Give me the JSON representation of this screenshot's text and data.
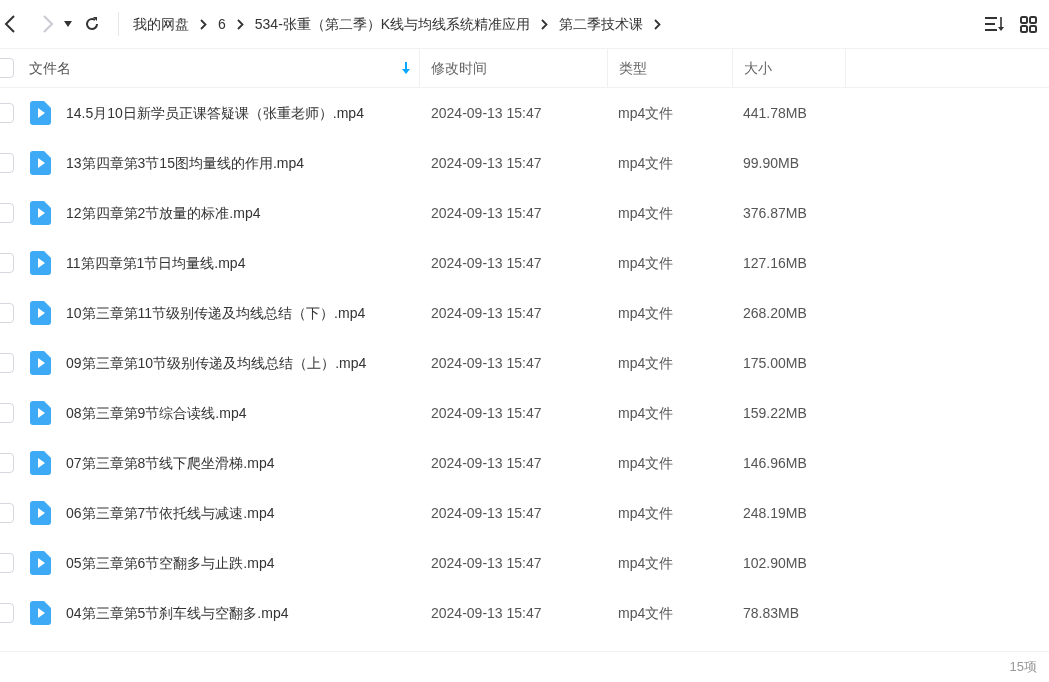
{
  "nav": {
    "back_disabled": false,
    "forward_disabled": true
  },
  "breadcrumb": [
    "我的网盘",
    "6",
    "534-张重（第二季）K线与均线系统精准应用",
    "第二季技术课"
  ],
  "columns": [
    {
      "label": "文件名",
      "sorted": true
    },
    {
      "label": "修改时间",
      "sorted": false
    },
    {
      "label": "类型",
      "sorted": false
    },
    {
      "label": "大小",
      "sorted": false
    }
  ],
  "header_checked": false,
  "rows": [
    {
      "name": "14.5月10日新学员正课答疑课（张重老师）.mp4",
      "time": "2024-09-13 15:47",
      "type": "mp4文件",
      "size": "441.78MB",
      "checked": false
    },
    {
      "name": "13第四章第3节15图均量线的作用.mp4",
      "time": "2024-09-13 15:47",
      "type": "mp4文件",
      "size": "99.90MB",
      "checked": false
    },
    {
      "name": "12第四章第2节放量的标准.mp4",
      "time": "2024-09-13 15:47",
      "type": "mp4文件",
      "size": "376.87MB",
      "checked": false
    },
    {
      "name": "11第四章第1节日均量线.mp4",
      "time": "2024-09-13 15:47",
      "type": "mp4文件",
      "size": "127.16MB",
      "checked": false
    },
    {
      "name": "10第三章第11节级别传递及均线总结（下）.mp4",
      "time": "2024-09-13 15:47",
      "type": "mp4文件",
      "size": "268.20MB",
      "checked": false
    },
    {
      "name": "09第三章第10节级别传递及均线总结（上）.mp4",
      "time": "2024-09-13 15:47",
      "type": "mp4文件",
      "size": "175.00MB",
      "checked": false
    },
    {
      "name": "08第三章第9节综合读线.mp4",
      "time": "2024-09-13 15:47",
      "type": "mp4文件",
      "size": "159.22MB",
      "checked": false
    },
    {
      "name": "07第三章第8节线下爬坐滑梯.mp4",
      "time": "2024-09-13 15:47",
      "type": "mp4文件",
      "size": "146.96MB",
      "checked": false
    },
    {
      "name": "06第三章第7节依托线与减速.mp4",
      "time": "2024-09-13 15:47",
      "type": "mp4文件",
      "size": "248.19MB",
      "checked": false
    },
    {
      "name": "05第三章第6节空翻多与止跌.mp4",
      "time": "2024-09-13 15:47",
      "type": "mp4文件",
      "size": "102.90MB",
      "checked": false
    },
    {
      "name": "04第三章第5节刹车线与空翻多.mp4",
      "time": "2024-09-13 15:47",
      "type": "mp4文件",
      "size": "78.83MB",
      "checked": false
    }
  ],
  "status_bar": {
    "count": "15项"
  }
}
